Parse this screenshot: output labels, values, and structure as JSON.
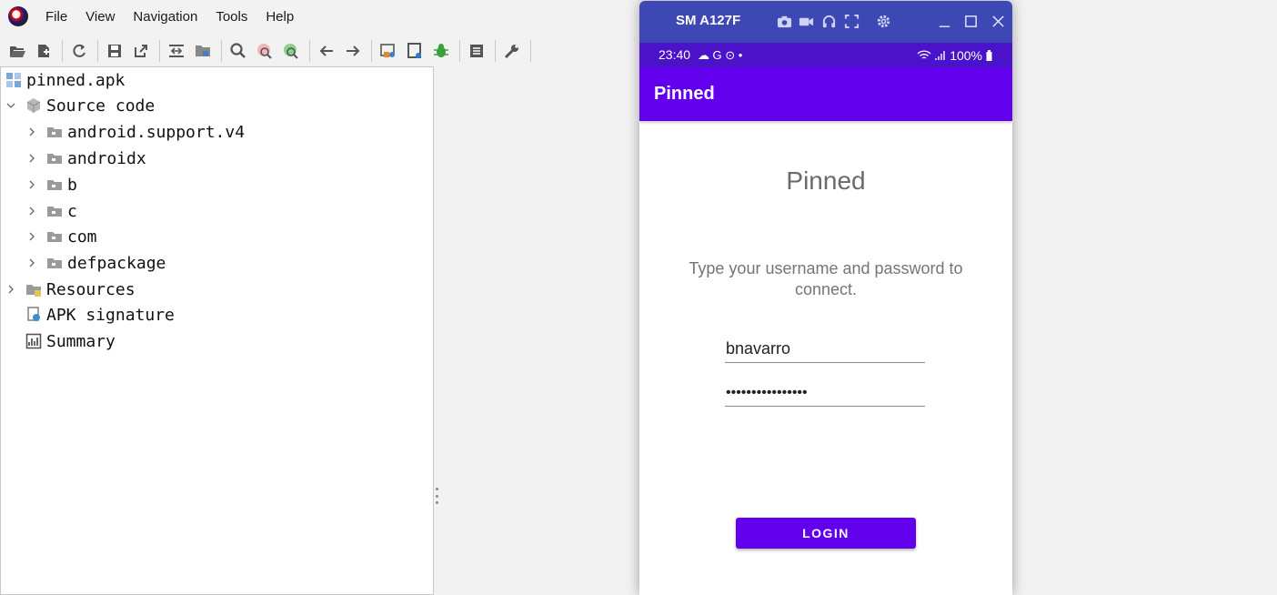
{
  "menu": {
    "items": [
      "File",
      "View",
      "Navigation",
      "Tools",
      "Help"
    ]
  },
  "toolbar": {
    "buttons": [
      "open-folder-icon",
      "add-files-icon",
      "sync-icon",
      "save-icon",
      "export-icon",
      "goto-class-icon",
      "project-tree-icon",
      "search-icon",
      "search-class-icon",
      "search-usage-icon",
      "back-arrow-icon",
      "forward-arrow-icon",
      "deobfuscation-icon",
      "quark-icon",
      "debug-bug-icon",
      "log-icon",
      "preferences-wrench-icon"
    ]
  },
  "tree": {
    "root": "pinned.apk",
    "source_code": "Source code",
    "packages": [
      "android.support.v4",
      "androidx",
      "b",
      "c",
      "com",
      "defpackage"
    ],
    "resources": "Resources",
    "apk_signature": "APK signature",
    "summary": "Summary"
  },
  "phone": {
    "device_name": "SM A127F",
    "status_time": "23:40",
    "status_left_icons": "☁ G ⊙ •",
    "battery": "100%",
    "app_title": "Pinned",
    "heading": "Pinned",
    "instructions": "Type your username and password to connect.",
    "username_value": "bnavarro",
    "password_value": "••••••••••••••••",
    "login_label": "LOGIN"
  },
  "colors": {
    "title_bar": "#3d48b5",
    "status_bar": "#4a12c9",
    "primary": "#6200ee"
  }
}
